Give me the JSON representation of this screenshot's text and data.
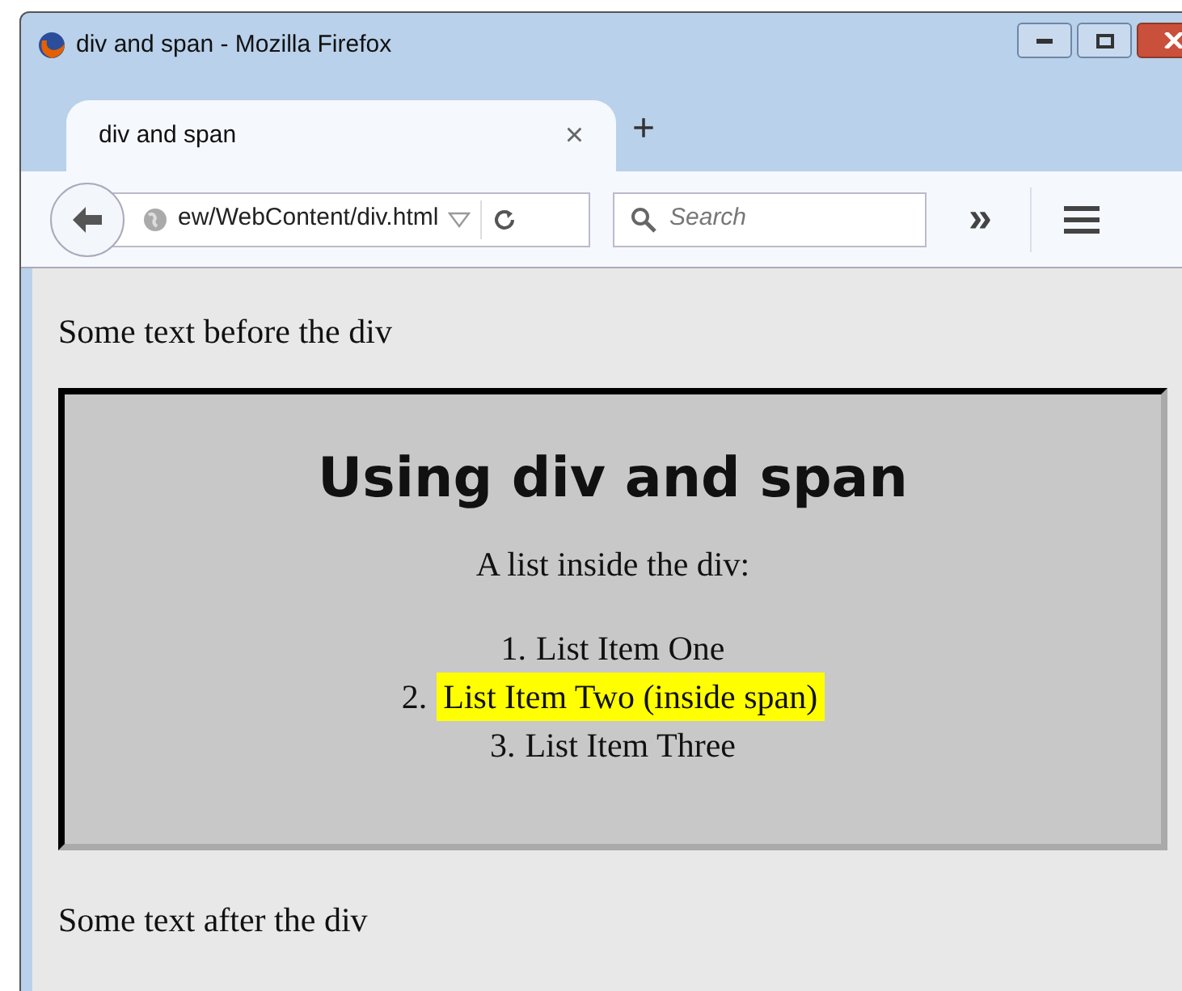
{
  "window": {
    "title": "div and span - Mozilla Firefox"
  },
  "tabs": [
    {
      "label": "div and span",
      "selected": true,
      "close": "×"
    }
  ],
  "new_tab": "+",
  "toolbar": {
    "url": "ew/WebContent/div.html",
    "search": {
      "placeholder": "Search"
    },
    "overflow": "»"
  },
  "page": {
    "before": "Some text before the div",
    "heading": "Using div and span",
    "intro": "A list inside the div:",
    "items": [
      {
        "number": "1.",
        "text": "List Item One",
        "highlighted": false
      },
      {
        "number": "2.",
        "text": "List Item Two (inside span)",
        "highlighted": true
      },
      {
        "number": "3.",
        "text": "List Item Three",
        "highlighted": false
      }
    ],
    "after": "Some text after the div"
  }
}
